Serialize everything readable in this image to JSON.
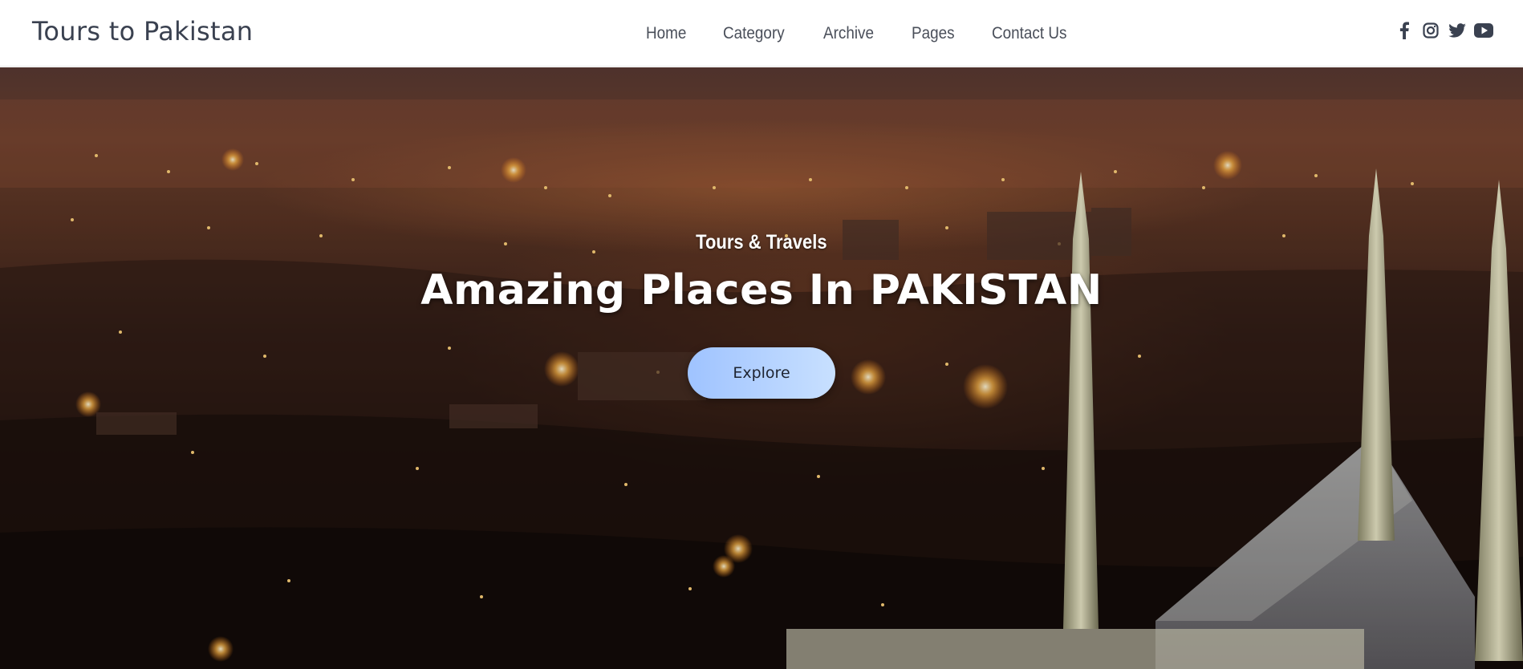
{
  "header": {
    "brand": "Tours to Pakistan",
    "nav": [
      "Home",
      "Category",
      "Archive",
      "Pages",
      "Contact Us"
    ],
    "social": [
      "facebook-icon",
      "instagram-icon",
      "twitter-icon",
      "youtube-icon"
    ]
  },
  "hero": {
    "kicker": "Tours & Travels",
    "headline": "Amazing Places In PAKISTAN",
    "button_label": "Explore",
    "background": "night cityscape with illuminated mosque minarets"
  },
  "colors": {
    "header_bg": "#ffffff",
    "brand_text": "#3a4150",
    "nav_text": "#4a4f5a",
    "button_gradient_start": "#9fc3ff",
    "button_gradient_end": "#c8e0ff"
  }
}
